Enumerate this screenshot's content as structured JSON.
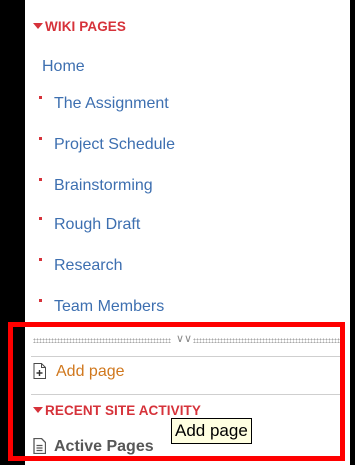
{
  "wiki_pages": {
    "header": "WIKI PAGES",
    "home": "Home",
    "items": [
      "The Assignment",
      "Project Schedule",
      "Brainstorming",
      "Rough Draft",
      "Research",
      "Team Members"
    ]
  },
  "actions": {
    "add_page": "Add page"
  },
  "recent_activity": {
    "header": "RECENT SITE ACTIVITY",
    "first_item": "Active Pages"
  },
  "tooltip": {
    "text": "Add page"
  },
  "colors": {
    "header_red": "#d6323a",
    "link_blue": "#3d6fb0",
    "add_orange": "#d0781e",
    "highlight_red": "#ff0000"
  },
  "icons": {
    "header_toggle": "caret-down-icon",
    "bullet": "bullet-icon",
    "grip": "resize-grip-icon",
    "add_page": "page-icon"
  }
}
